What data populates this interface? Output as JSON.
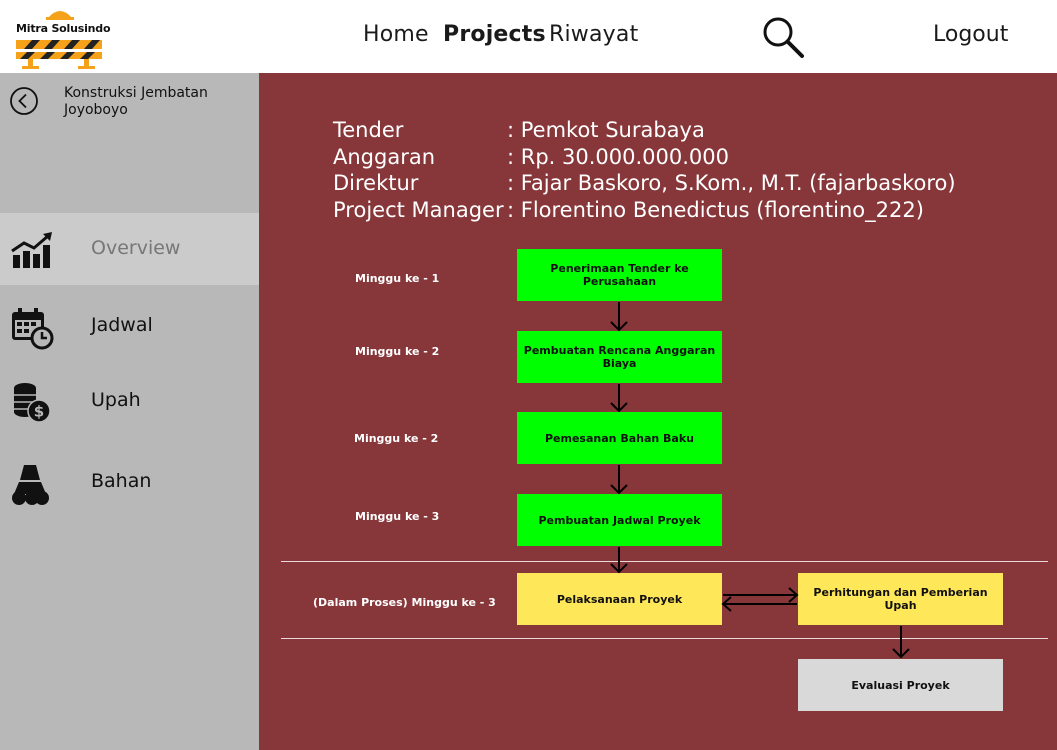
{
  "header": {
    "logo_text": "Mitra Solusindo",
    "nav": [
      {
        "label": "Home",
        "active": false
      },
      {
        "label": "Projects",
        "active": true
      },
      {
        "label": "Riwayat",
        "active": false
      }
    ],
    "search_icon": "search-icon",
    "logout_label": "Logout"
  },
  "sidebar": {
    "back_icon": "back-circle-icon",
    "project_name": "Konstruksi Jembatan Joyoboyo",
    "items": [
      {
        "label": "Overview",
        "icon": "chart-growth-icon",
        "active": true
      },
      {
        "label": "Jadwal",
        "icon": "calendar-clock-icon",
        "active": false
      },
      {
        "label": "Upah",
        "icon": "coins-dollar-icon",
        "active": false
      },
      {
        "label": "Bahan",
        "icon": "materials-icon",
        "active": false
      }
    ]
  },
  "project_info": [
    {
      "key": "Tender",
      "value": ": Pemkot Surabaya"
    },
    {
      "key": "Anggaran",
      "value": ": Rp. 30.000.000.000"
    },
    {
      "key": "Direktur",
      "value": ": Fajar Baskoro, S.Kom., M.T. (fajarbaskoro)"
    },
    {
      "key": "Project Manager",
      "value": ": Florentino Benedictus (florentino_222)"
    }
  ],
  "flow": {
    "weeks": [
      "Minggu ke - 1",
      "Minggu ke - 2",
      "Minggu ke - 2",
      "Minggu ke - 3",
      "(Dalam Proses) Minggu ke - 3"
    ],
    "steps": [
      {
        "label": "Penerimaan Tender ke Perusahaan",
        "status": "done"
      },
      {
        "label": "Pembuatan Rencana Anggaran Biaya",
        "status": "done"
      },
      {
        "label": "Pemesanan Bahan Baku",
        "status": "done"
      },
      {
        "label": "Pembuatan Jadwal Proyek",
        "status": "done"
      },
      {
        "label": "Pelaksanaan Proyek",
        "status": "in-progress"
      },
      {
        "label": "Perhitungan dan Pemberian Upah",
        "status": "in-progress"
      },
      {
        "label": "Evaluasi Proyek",
        "status": "pending"
      }
    ]
  },
  "colors": {
    "main_bg": "#87373a",
    "sidebar_bg": "#b8b8b8",
    "done": "#00ff00",
    "in_progress": "#ffe75a",
    "pending": "#d9d9d9",
    "logo_accent": "#f5a21a"
  }
}
